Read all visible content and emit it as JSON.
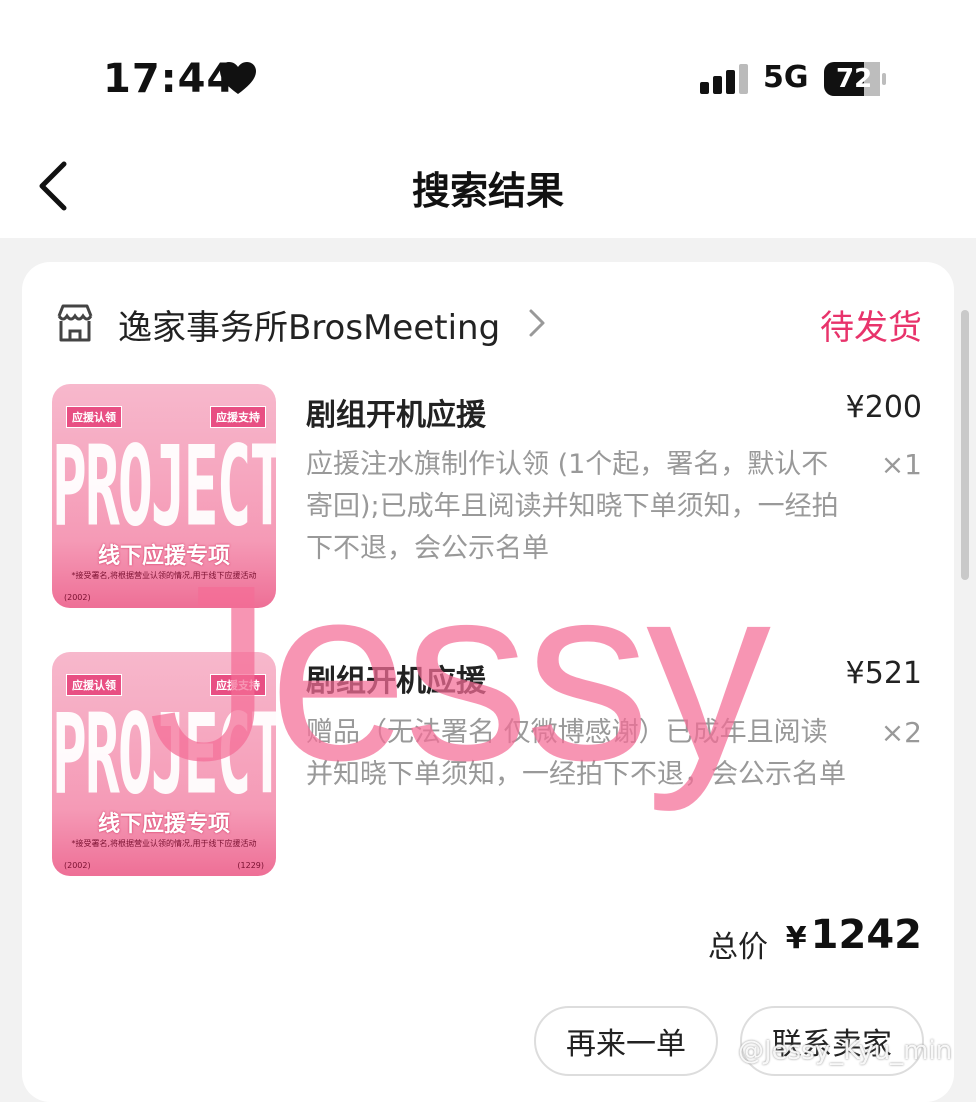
{
  "status_bar": {
    "time": "17:44",
    "network": "5G",
    "battery": "72",
    "icons": [
      "heart-icon",
      "signal-icon",
      "battery-icon"
    ]
  },
  "nav": {
    "back_icon": "chevron-left-icon",
    "title": "搜索结果"
  },
  "order": {
    "store_icon": "store-icon",
    "store_name": "逸家事务所BrosMeeting",
    "store_chevron": "chevron-right-icon",
    "status": "待发货",
    "items": [
      {
        "thumb": {
          "tag_left": "应援认领",
          "tag_right": "应援支持",
          "big": "PROJECTX",
          "sub": "线下应援专项",
          "tiny": "*接受署名,将根据营业认领的情况,用于线下应援活动",
          "foot_left": "(2002)",
          "foot_right": ""
        },
        "name": "剧组开机应援",
        "price": "¥200",
        "desc": "应援注水旗制作认领 (1个起，署名，默认不寄回);已成年且阅读并知晓下单须知，一经拍下不退，会公示名单",
        "qty": "×1"
      },
      {
        "thumb": {
          "tag_left": "应援认领",
          "tag_right": "应援支持",
          "big": "PROJECTX",
          "sub": "线下应援专项",
          "tiny": "*接受署名,将根据营业认领的情况,用于线下应援活动",
          "foot_left": "(2002)",
          "foot_right": "(1229)"
        },
        "name": "剧组开机应援",
        "price": "¥521",
        "desc": "赠品（无法署名 仅微博感谢）已成年且阅读并知晓下单须知，一经拍下不退，会公示名单",
        "qty": "×2"
      }
    ],
    "total_label": "总价",
    "total_currency": "¥",
    "total_value": "1242",
    "buttons": {
      "again": "再来一单",
      "contact": "联系卖家"
    }
  },
  "watermark": "Jessy",
  "weibo_mark": "@Jessy_Kyu_min",
  "colors": {
    "accent": "#e8336b",
    "background": "#f2f2f2",
    "card": "#ffffff",
    "muted_text": "#999999"
  }
}
